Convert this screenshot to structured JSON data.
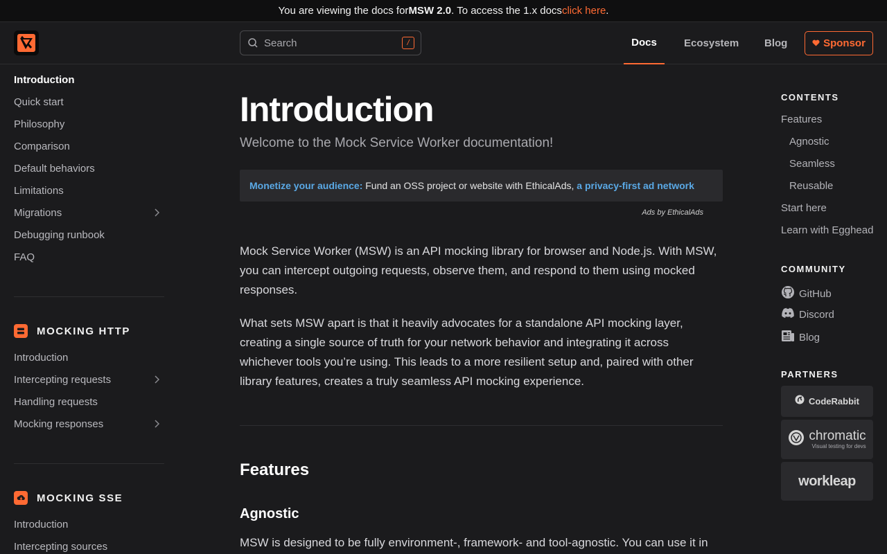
{
  "banner": {
    "prefix": "You are viewing the docs for ",
    "version": "MSW 2.0",
    "middle": ". To access the 1.x docs ",
    "link": "click here",
    "suffix": "."
  },
  "header": {
    "search_placeholder": "Search",
    "search_shortcut": "/",
    "nav": {
      "docs": "Docs",
      "ecosystem": "Ecosystem",
      "blog": "Blog"
    },
    "sponsor": "Sponsor"
  },
  "sidebar": {
    "items": [
      {
        "label": "Introduction",
        "active": true
      },
      {
        "label": "Quick start"
      },
      {
        "label": "Philosophy"
      },
      {
        "label": "Comparison"
      },
      {
        "label": "Default behaviors"
      },
      {
        "label": "Limitations"
      },
      {
        "label": "Migrations",
        "expandable": true
      },
      {
        "label": "Debugging runbook"
      },
      {
        "label": "FAQ"
      }
    ],
    "sections": [
      {
        "title": "MOCKING HTTP",
        "icon": "server-icon",
        "items": [
          {
            "label": "Introduction"
          },
          {
            "label": "Intercepting requests",
            "expandable": true
          },
          {
            "label": "Handling requests"
          },
          {
            "label": "Mocking responses",
            "expandable": true
          }
        ]
      },
      {
        "title": "MOCKING SSE",
        "icon": "cloud-download-icon",
        "items": [
          {
            "label": "Introduction"
          },
          {
            "label": "Intercepting sources"
          }
        ]
      }
    ]
  },
  "main": {
    "title": "Introduction",
    "subtitle": "Welcome to the Mock Service Worker documentation!",
    "ad": {
      "headline": "Monetize your audience:",
      "body": " Fund an OSS project or website with EthicalAds, ",
      "link": "a privacy-first ad network",
      "attribution": "Ads by EthicalAds"
    },
    "paragraphs": [
      "Mock Service Worker (MSW) is an API mocking library for browser and Node.js. With MSW, you can intercept outgoing requests, observe them, and respond to them using mocked responses.",
      "What sets MSW apart is that it heavily advocates for a standalone API mocking layer, creating a single source of truth for your network behavior and integrating it across whichever tools you’re using. This leads to a more resilient setup and, paired with other library features, creates a truly seamless API mocking experience.",
      "MSW is designed to be fully environment-, framework- and tool-agnostic. You can use it in"
    ],
    "h2": "Features",
    "h3": "Agnostic"
  },
  "toc": {
    "contents_heading": "CONTENTS",
    "contents": [
      {
        "label": "Features"
      },
      {
        "label": "Agnostic",
        "sub": true
      },
      {
        "label": "Seamless",
        "sub": true
      },
      {
        "label": "Reusable",
        "sub": true
      },
      {
        "label": "Start here"
      },
      {
        "label": "Learn with Egghead"
      }
    ],
    "community_heading": "COMMUNITY",
    "community": [
      {
        "label": "GitHub",
        "icon": "github-icon"
      },
      {
        "label": "Discord",
        "icon": "discord-icon"
      },
      {
        "label": "Blog",
        "icon": "newspaper-icon"
      }
    ],
    "partners_heading": "PARTNERS",
    "partners": [
      {
        "name": "CodeRabbit"
      },
      {
        "name": "chromatic",
        "tagline": "Visual testing for devs"
      },
      {
        "name": "workleap"
      }
    ]
  },
  "colors": {
    "accent": "#ff6a33",
    "link_blue": "#5aa9e6",
    "background": "#1b1b1d"
  }
}
